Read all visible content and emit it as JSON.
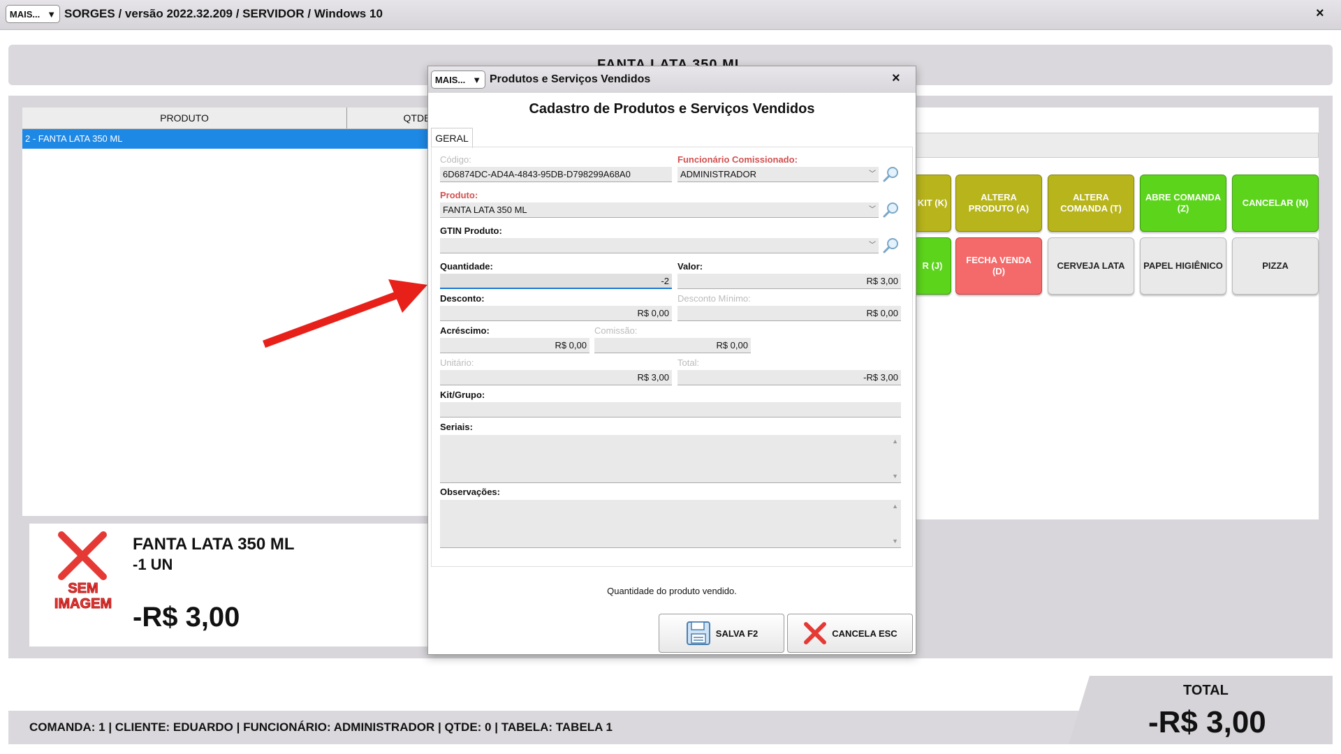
{
  "window": {
    "menu_label": "MAIS...",
    "title": "SORGES / versão 2022.32.209 / SERVIDOR / Windows 10",
    "close": "×"
  },
  "header": {
    "title": "FANTA LATA 350 ML"
  },
  "grid": {
    "columns": [
      "PRODUTO",
      "QTDE"
    ],
    "rows": [
      {
        "label": "2 - FANTA LATA 350 ML"
      }
    ]
  },
  "product_info": {
    "no_image_line1": "SEM",
    "no_image_line2": "IMAGEM",
    "name": "FANTA LATA 350 ML",
    "qty": "-1  UN",
    "price": "-R$ 3,00"
  },
  "tiles": [
    {
      "label": "KIT (K)",
      "color": "olive"
    },
    {
      "label": "ALTERA PRODUTO (A)",
      "color": "olive"
    },
    {
      "label": "ALTERA COMANDA (T)",
      "color": "olive"
    },
    {
      "label": "ABRE COMANDA (Z)",
      "color": "green"
    },
    {
      "label": "CANCELAR (N)",
      "color": "green"
    },
    {
      "label": "R (J)",
      "color": "green"
    },
    {
      "label": "FECHA VENDA (D)",
      "color": "red"
    },
    {
      "label": "CERVEJA LATA",
      "color": "gray"
    },
    {
      "label": "PAPEL HIGIÊNICO",
      "color": "gray"
    },
    {
      "label": "PIZZA",
      "color": "gray"
    }
  ],
  "footer": {
    "status": "COMANDA: 1  |  CLIENTE: EDUARDO  |  FUNCIONÁRIO: ADMINISTRADOR  |  QTDE: 0  |  TABELA: TABELA 1",
    "total_label": "TOTAL",
    "total_value": "-R$ 3,00"
  },
  "dialog": {
    "menu_label": "MAIS...",
    "title": "Produtos e Serviços Vendidos",
    "close": "×",
    "heading": "Cadastro de Produtos e Serviços Vendidos",
    "tab": "GERAL",
    "fields": {
      "codigo_label": "Código:",
      "codigo_value": "6D6874DC-AD4A-4843-95DB-D798299A68A0",
      "funcionario_label": "Funcionário Comissionado:",
      "funcionario_value": "ADMINISTRADOR",
      "produto_label": "Produto:",
      "produto_value": "FANTA LATA 350 ML",
      "gtin_label": "GTIN Produto:",
      "gtin_value": "",
      "quantidade_label": "Quantidade:",
      "quantidade_value": "-2",
      "valor_label": "Valor:",
      "valor_value": "R$ 3,00",
      "desconto_label": "Desconto:",
      "desconto_value": "R$ 0,00",
      "desconto_min_label": "Desconto Mínimo:",
      "desconto_min_value": "R$ 0,00",
      "acrescimo_label": "Acréscimo:",
      "acrescimo_value": "R$ 0,00",
      "comissao_label": "Comissão:",
      "comissao_value": "R$ 0,00",
      "unitario_label": "Unitário:",
      "unitario_value": "R$ 3,00",
      "total_label": "Total:",
      "total_value": "-R$ 3,00",
      "kit_label": "Kit/Grupo:",
      "kit_value": "",
      "seriais_label": "Seriais:",
      "observacoes_label": "Observações:"
    },
    "hint": "Quantidade do produto vendido.",
    "save_label": "SALVA F2",
    "cancel_label": "CANCELA ESC"
  },
  "colors": {
    "selection": "#1e88e5",
    "olive": "#b8b41c",
    "green": "#5cd41c",
    "red": "#f46a6a",
    "arrow": "#e8201a"
  }
}
